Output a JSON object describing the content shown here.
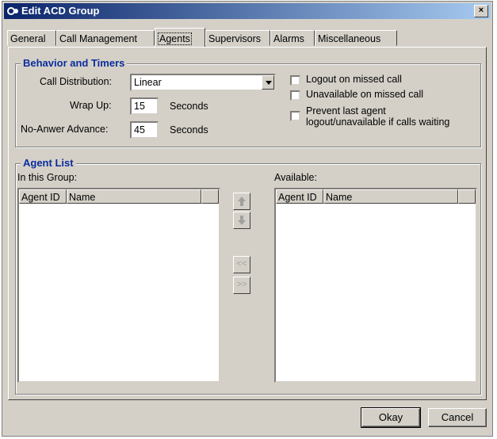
{
  "window": {
    "title": "Edit ACD Group",
    "close_glyph": "×"
  },
  "tabs": [
    {
      "label": "General"
    },
    {
      "label": "Call Management"
    },
    {
      "label": "Agents",
      "active": true
    },
    {
      "label": "Supervisors"
    },
    {
      "label": "Alarms"
    },
    {
      "label": "Miscellaneous"
    }
  ],
  "behavior": {
    "title": "Behavior and Timers",
    "call_distribution": {
      "label": "Call Distribution:",
      "value": "Linear"
    },
    "wrap_up": {
      "label": "Wrap Up:",
      "value": "15",
      "unit": "Seconds"
    },
    "no_answer_advance": {
      "label": "No-Anwer Advance:",
      "value": "45",
      "unit": "Seconds"
    },
    "checkboxes": [
      {
        "label": "Logout on missed call",
        "checked": false
      },
      {
        "label": "Unavailable on missed call",
        "checked": false
      },
      {
        "label_line1": "Prevent last agent",
        "label_line2": "logout/unavailable if calls waiting",
        "checked": false
      }
    ]
  },
  "agent_list": {
    "title": "Agent List",
    "in_group": {
      "label": "In this Group:",
      "columns": [
        "Agent ID",
        "Name"
      ],
      "rows": []
    },
    "available": {
      "label": "Available:",
      "columns": [
        "Agent ID",
        "Name"
      ],
      "rows": []
    },
    "buttons": {
      "move_all_left": "<<",
      "move_all_right": ">>"
    }
  },
  "footer": {
    "ok_label": "Okay",
    "cancel_label": "Cancel"
  },
  "colors": {
    "title_start": "#0a246a",
    "title_end": "#a6caf0",
    "group_title": "#0b2d9e",
    "face": "#d4d0c8"
  }
}
